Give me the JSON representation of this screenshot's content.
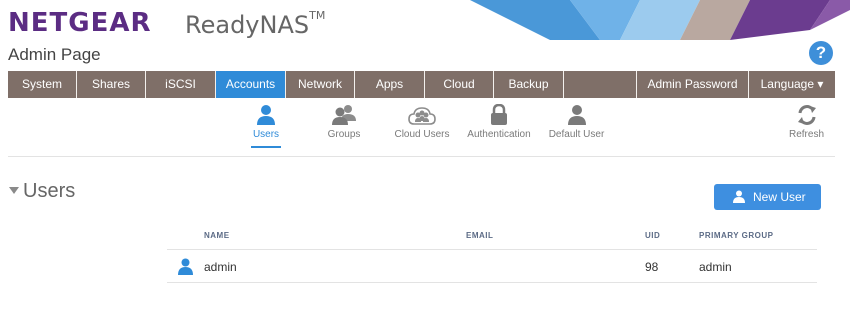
{
  "header": {
    "brand": "NETGEAR",
    "product": "ReadyNAS",
    "trademark": "TM",
    "page_title": "Admin Page"
  },
  "nav": {
    "items": [
      {
        "label": "System"
      },
      {
        "label": "Shares"
      },
      {
        "label": "iSCSI"
      },
      {
        "label": "Accounts"
      },
      {
        "label": "Network"
      },
      {
        "label": "Apps"
      },
      {
        "label": "Cloud"
      },
      {
        "label": "Backup"
      },
      {
        "label": ""
      },
      {
        "label": "Admin Password"
      },
      {
        "label": "Language ▾"
      }
    ],
    "active": "Accounts"
  },
  "subnav": {
    "items": [
      {
        "label": "Users"
      },
      {
        "label": "Groups"
      },
      {
        "label": "Cloud Users"
      },
      {
        "label": "Authentication"
      },
      {
        "label": "Default User"
      }
    ],
    "refresh_label": "Refresh",
    "active": "Users"
  },
  "section": {
    "title": "Users",
    "new_user_label": "New User"
  },
  "table": {
    "columns": [
      "NAME",
      "EMAIL",
      "UID",
      "PRIMARY GROUP"
    ],
    "rows": [
      {
        "name": "admin",
        "email": "",
        "uid": "98",
        "group": "admin"
      }
    ]
  },
  "colors": {
    "brand_purple": "#5b2c83",
    "nav_bg": "#7f6f68",
    "accent_blue": "#2f8bd8"
  }
}
